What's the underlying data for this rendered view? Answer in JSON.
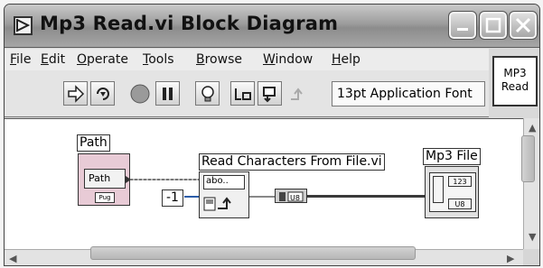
{
  "window": {
    "title": "Mp3 Read.vi Block Diagram"
  },
  "menu": {
    "items": [
      {
        "label": "File"
      },
      {
        "label": "Edit"
      },
      {
        "label": "Operate"
      },
      {
        "label": "Tools"
      },
      {
        "label": "Browse"
      },
      {
        "label": "Window"
      },
      {
        "label": "Help"
      }
    ]
  },
  "toolbar": {
    "font_selector": "13pt Application Font",
    "buttons": [
      "run-arrow-icon",
      "run-continuously-icon",
      "abort-icon",
      "pause-icon",
      "highlight-execution-icon",
      "retain-wire-values-icon",
      "step-into-icon",
      "step-out-icon"
    ]
  },
  "vi_icon": {
    "line1": "MP3",
    "line2": "Read"
  },
  "diagram": {
    "path_label": "Path",
    "path_terminal_text": "Path",
    "path_terminal_type": "Pug",
    "constant_value": "-1",
    "function_label": "Read Characters From File.vi",
    "function_inner_text": "abo..",
    "output_label": "Mp3 File",
    "output_values": [
      "123",
      "U8"
    ]
  }
}
